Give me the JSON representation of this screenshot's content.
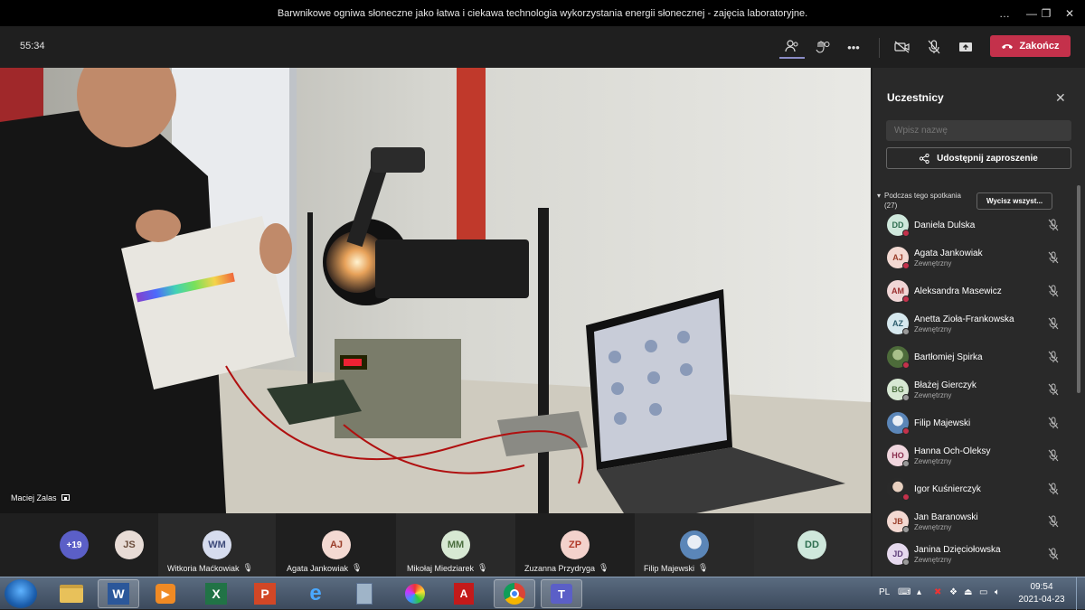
{
  "window": {
    "title": "Barwnikowe ogniwa słoneczne jako łatwa i ciekawa technologia wykorzystania energii słonecznej - zajęcia laboratoryjne.",
    "controls": [
      "…",
      "—",
      "❐",
      "✕"
    ]
  },
  "meeting": {
    "timer": "55:34",
    "end_label": "Zakończ",
    "speaker_name": "Maciej Zalas"
  },
  "video_strip": {
    "overflow_count": "+19",
    "tiles": [
      {
        "initials": "JS",
        "name": "",
        "color": "#e8dcd6",
        "text": "#6b4e3d"
      },
      {
        "initials": "WM",
        "name": "Witkoria Maćkowiak",
        "color": "#d6dcee",
        "text": "#3d4a7a"
      },
      {
        "initials": "AJ",
        "name": "Agata Jankowiak",
        "color": "#f3d9d2",
        "text": "#9a3e2a"
      },
      {
        "initials": "MM",
        "name": "Mikołaj Miedziarek",
        "color": "#d7e8d3",
        "text": "#4a6e3e"
      },
      {
        "initials": "ZP",
        "name": "Zuzanna Przydryga",
        "color": "#f3d2cc",
        "text": "#b13b2a"
      },
      {
        "initials": "",
        "name": "Filip Majewski",
        "color": "#5b86b8",
        "text": "#fff"
      },
      {
        "initials": "DD",
        "name": "",
        "color": "#cfe8dc",
        "text": "#2e6e50"
      }
    ]
  },
  "participants": {
    "title": "Uczestnicy",
    "search_placeholder": "Wpisz nazwę",
    "share_label": "Udostępnij zaproszenie",
    "section_label": "Podczas tego spotkania",
    "section_count": "(27)",
    "clear_label": "Wycisz wszyst...",
    "list": [
      {
        "initials": "DD",
        "name": "Daniela Dulska",
        "sub": "",
        "color": "#cfe8dc",
        "text": "#2e6e50",
        "dot": "#c4314b"
      },
      {
        "initials": "AJ",
        "name": "Agata Jankowiak",
        "sub": "Zewnętrzny",
        "color": "#f3d9d2",
        "text": "#9a3e2a",
        "dot": "#c4314b"
      },
      {
        "initials": "AM",
        "name": "Aleksandra Masewicz",
        "sub": "",
        "color": "#f0d6d6",
        "text": "#9a2e2e",
        "dot": "#c4314b"
      },
      {
        "initials": "AZ",
        "name": "Anetta Zioła-Frankowska",
        "sub": "Zewnętrzny",
        "color": "#d6e8ee",
        "text": "#2e5e6e",
        "dot": "#999"
      },
      {
        "initials": "",
        "name": "Bartłomiej Spirka",
        "sub": "",
        "color": "#4d6b3a",
        "text": "#fff",
        "dot": "#c4314b"
      },
      {
        "initials": "BG",
        "name": "Błażej Gierczyk",
        "sub": "Zewnętrzny",
        "color": "#d7e8d3",
        "text": "#4a6e3e",
        "dot": "#999"
      },
      {
        "initials": "",
        "name": "Filip Majewski",
        "sub": "",
        "color": "#5b86b8",
        "text": "#fff",
        "dot": "#c4314b"
      },
      {
        "initials": "HO",
        "name": "Hanna Och-Oleksy",
        "sub": "Zewnętrzny",
        "color": "#f0d6de",
        "text": "#8a2e4e",
        "dot": "#999"
      },
      {
        "initials": "",
        "name": "Igor Kuśnierczyk",
        "sub": "",
        "color": "#3a3a3a",
        "text": "#fff",
        "dot": "#c4314b"
      },
      {
        "initials": "JB",
        "name": "Jan Baranowski",
        "sub": "Zewnętrzny",
        "color": "#f3d9d2",
        "text": "#9a3e2a",
        "dot": "#999"
      },
      {
        "initials": "JD",
        "name": "Janina Dzięciołowska",
        "sub": "Zewnętrzny",
        "color": "#e6d9ee",
        "text": "#5e3e7a",
        "dot": "#999"
      }
    ]
  },
  "taskbar": {
    "apps": [
      "file-explorer",
      "word",
      "video-player",
      "excel",
      "powerpoint",
      "internet-explorer",
      "calculator",
      "paint",
      "acrobat",
      "chrome",
      "teams"
    ],
    "lang": "PL",
    "time": "09:54",
    "date": "2021-04-23"
  },
  "colors": {
    "accent": "#8b8cc7",
    "end_call": "#c4314b",
    "background": "#1f1f1f",
    "panel": "#292929"
  }
}
